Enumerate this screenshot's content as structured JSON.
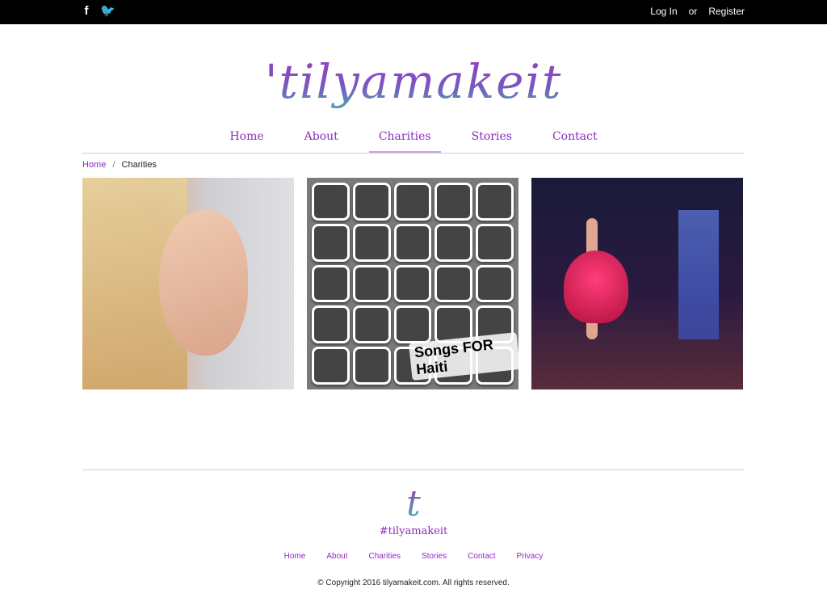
{
  "topbar": {
    "social": [
      {
        "icon": "facebook-icon",
        "glyph": "f"
      },
      {
        "icon": "twitter-icon",
        "glyph": "🐦"
      }
    ],
    "login_label": "Log In",
    "or_label": "or",
    "register_label": "Register"
  },
  "brand": {
    "logo_text": "'tilyamakeit",
    "accent_color": "#8c2bbf",
    "gradient_start": "#9b3bb8",
    "gradient_end": "#3fc1a6"
  },
  "nav": {
    "items": [
      {
        "label": "Home",
        "active": false
      },
      {
        "label": "About",
        "active": false
      },
      {
        "label": "Charities",
        "active": true
      },
      {
        "label": "Stories",
        "active": false
      },
      {
        "label": "Contact",
        "active": false
      }
    ]
  },
  "breadcrumb": {
    "home_label": "Home",
    "current_label": "Charities"
  },
  "gallery": {
    "tiles": [
      {
        "name": "portrait-photo"
      },
      {
        "name": "collage-photo",
        "caption": "Songs FOR Haiti"
      },
      {
        "name": "ballet-photo"
      }
    ]
  },
  "footer": {
    "mark": "t",
    "hashtag": "#tilyamakeit",
    "links": [
      "Home",
      "About",
      "Charities",
      "Stories",
      "Contact",
      "Privacy"
    ],
    "copyright": "© Copyright 2016 tilyamakeit.com. All rights reserved."
  }
}
